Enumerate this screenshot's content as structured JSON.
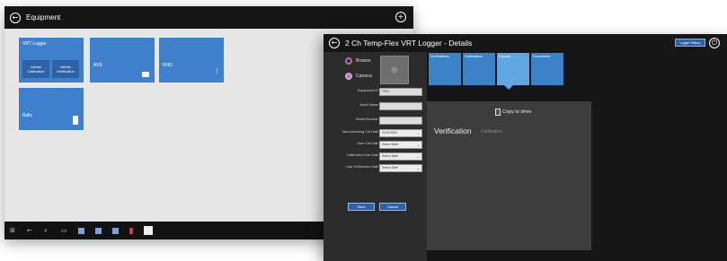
{
  "equipment_window": {
    "title": "Equipment",
    "tiles": [
      {
        "label": "VRT Logger",
        "actions": [
          "Initiate Calibration",
          "Initiate Verification"
        ]
      },
      {
        "label": "AVS"
      },
      {
        "label": "RHD"
      },
      {
        "label": "Balls"
      }
    ]
  },
  "details_window": {
    "title": "2 Ch Temp-Flex VRT Logger - Details",
    "history_button": "Logger History",
    "image_options": {
      "browse": "Browse",
      "camera": "Camera"
    },
    "form": {
      "equipment_id": {
        "label": "Equipment ID",
        "value": "7923"
      },
      "asset_name": {
        "label": "Asset Name",
        "value": ""
      },
      "model_number": {
        "label": "Model Number",
        "value": ""
      },
      "manufacturing_cal_date": {
        "label": "Manufacturing Cal Date",
        "value": "01/01/0001"
      },
      "user_cal_date": {
        "label": "User Cal Date",
        "value": "Select Date"
      },
      "calibration_due_date": {
        "label": "Calibration Due Date",
        "value": "Select Date"
      },
      "last_verification_date": {
        "label": "Last Verification Date",
        "value": "Select Date"
      }
    },
    "buttons": {
      "save": "Save",
      "cancel": "Cancel"
    },
    "tabs": [
      "Verifications",
      "Calibrations",
      "Reports",
      "Documents"
    ],
    "selected_tab": 2,
    "content": {
      "copy_to_drive": "Copy to drive",
      "verification": "Verification",
      "calibration": "Calibration"
    }
  },
  "colors": {
    "tile_blue": "#3e80cc",
    "tab_selected": "#5fa7e0",
    "radio_accent": "#b46fb0"
  }
}
